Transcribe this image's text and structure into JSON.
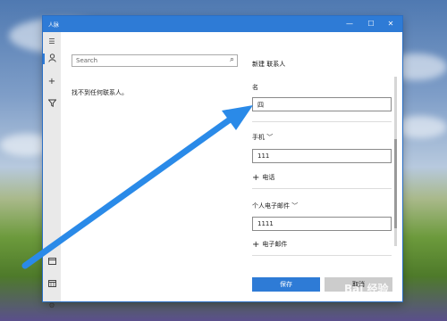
{
  "window": {
    "app_title": "人脉",
    "minimize_glyph": "—",
    "maximize_glyph": "☐",
    "close_glyph": "✕"
  },
  "rail": {
    "icons": [
      "hamburger-menu-icon",
      "person-icon",
      "plus-icon",
      "filter-icon",
      "calendar-icon",
      "calendar-grid-icon",
      "settings-icon"
    ]
  },
  "contacts": {
    "search_placeholder": "Search",
    "empty_message": "找不到任何联系人。"
  },
  "form": {
    "title": "新建 联系人",
    "name_label": "名",
    "name_value": "四",
    "phone_label": "手机",
    "phone_value": "111",
    "add_phone": "电话",
    "email_label": "个人电子邮件",
    "email_value": "1111",
    "add_email": "电子邮件",
    "save_label": "保存",
    "cancel_label": "取消"
  },
  "watermark": "Bai 经验",
  "colors": {
    "accent": "#2e7bd6",
    "arrow": "#2a8ae8"
  }
}
